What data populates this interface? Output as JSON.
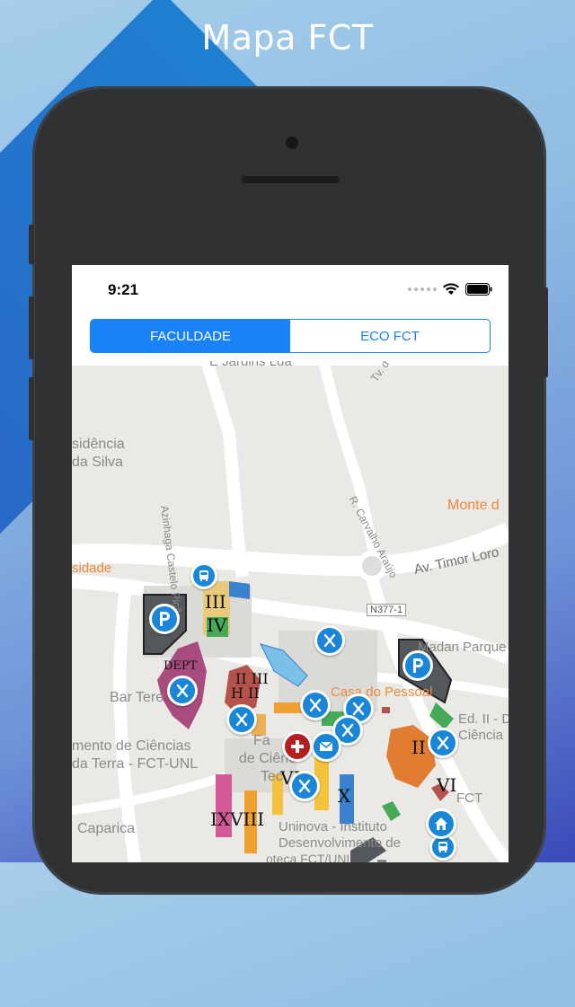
{
  "banner": {
    "title": "Mapa FCT"
  },
  "status_bar": {
    "time": "9:21"
  },
  "segmented_control": {
    "selected": "FACULDADE",
    "options": [
      {
        "label": "FACULDADE",
        "active": true
      },
      {
        "label": "ECO FCT",
        "active": false
      }
    ]
  },
  "map": {
    "street_labels": [
      "E Jardins Lda",
      "Tv. d",
      "sidência",
      "da Silva",
      "Azinhaga Castelo Picão",
      "R. Carvalho Araújo",
      "Monte d",
      "Av. Timor Loro",
      "sidade",
      "N377-1",
      "Madan Parque",
      "Bar Tere",
      "mento de Ciências",
      "da Terra - FCT-UNL",
      "Casa do Pessoal",
      "Fa",
      "de Ciênc",
      "Tec",
      "Ed. II - Dep",
      "Ciência",
      "FCT",
      "Uninova - Instituto",
      "Desenvolvimento de",
      "Caparica",
      "oteca FCT/UNL"
    ],
    "building_labels": [
      "III",
      "IV",
      "DEPT",
      "II III",
      "H II",
      "I",
      "VII",
      "X",
      "II",
      "VI",
      "IX",
      "VIII"
    ],
    "icons": [
      "parking-icon",
      "parking-icon",
      "bus-stop-icon",
      "bus-stop-icon",
      "restaurant-icon",
      "restaurant-icon",
      "restaurant-icon",
      "restaurant-icon",
      "restaurant-icon",
      "restaurant-icon",
      "restaurant-icon",
      "restaurant-icon",
      "mail-icon",
      "first-aid-icon",
      "home-icon"
    ]
  },
  "colors": {
    "accent": "#1a82f7",
    "pin_blue": "#1a86d8",
    "pin_red": "#b51f22",
    "map_bg": "#ebe9e6"
  }
}
